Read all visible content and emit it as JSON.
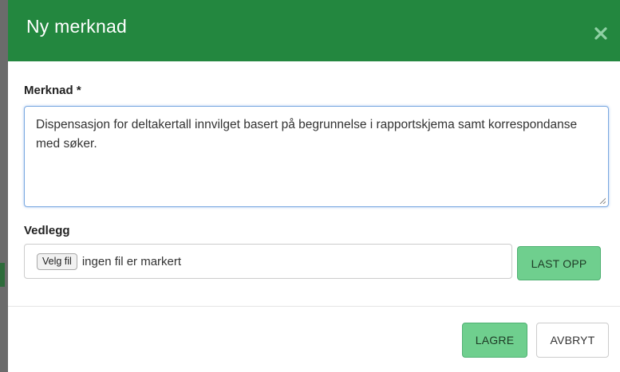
{
  "modal": {
    "title": "Ny merknad",
    "close_icon": "close-icon",
    "header_color": "#23873f"
  },
  "form": {
    "note_label": "Merknad *",
    "note_value": "Dispensasjon for deltakertall innvilget basert på begrunnelse i rapportskjema samt korrespondanse med søker.",
    "attachment_label": "Vedlegg",
    "file_button_label": "Velg fil",
    "file_status": "ingen fil er markert",
    "upload_label": "LAST OPP"
  },
  "footer": {
    "save_label": "LAGRE",
    "cancel_label": "AVBRYT",
    "accent": "#6fcf8e"
  }
}
